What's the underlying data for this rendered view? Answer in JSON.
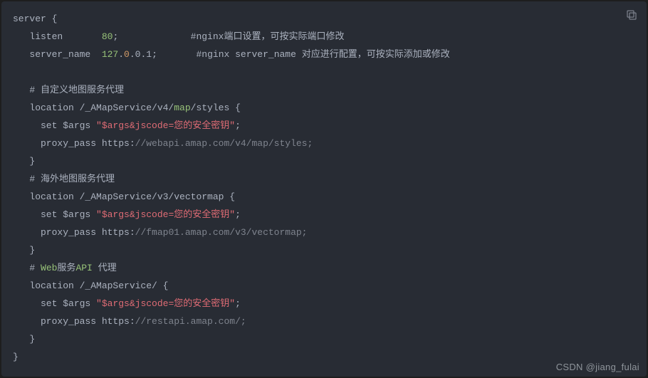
{
  "watermark": "CSDN @jiang_fulai",
  "code": {
    "l1": {
      "a": "server {"
    },
    "l2": {
      "a": "   listen       ",
      "b": "80",
      "c": ";             ",
      "d": "#nginx端口设置，可按实际端口修改"
    },
    "l3": {
      "a": "   server_name  ",
      "b": "127",
      "c": ".",
      "d": "0",
      "e": ".0.1;       ",
      "f": "#nginx server_name 对应进行配置，可按实际添加或修改"
    },
    "l4": {
      "a": ""
    },
    "l5": {
      "a": "   ",
      "b": "# 自定义地图服务代理"
    },
    "l6": {
      "a": "   location /_AMapService/v4/",
      "b": "map",
      "c": "/styles {"
    },
    "l7": {
      "a": "     set $args ",
      "b": "\"$args&jscode=您的安全密钥\"",
      "c": ";"
    },
    "l8": {
      "a": "     proxy_pass https:",
      "b": "//webapi.amap.com/v4/map/styles;"
    },
    "l9": {
      "a": "   }"
    },
    "l10": {
      "a": "   ",
      "b": "# 海外地图服务代理"
    },
    "l11": {
      "a": "   location /_AMapService/v3/vectormap {"
    },
    "l12": {
      "a": "     set $args ",
      "b": "\"$args&jscode=您的安全密钥\"",
      "c": ";"
    },
    "l13": {
      "a": "     proxy_pass https:",
      "b": "//fmap01.amap.com/v3/vectormap;"
    },
    "l14": {
      "a": "   }"
    },
    "l15": {
      "a": "   ",
      "b": "# ",
      "c": "Web",
      "d": "服务",
      "e": "API",
      "f": " 代理"
    },
    "l16": {
      "a": "   location /_AMapService/ {"
    },
    "l17": {
      "a": "     set $args ",
      "b": "\"$args&jscode=您的安全密钥\"",
      "c": ";"
    },
    "l18": {
      "a": "     proxy_pass https:",
      "b": "//restapi.amap.com/;"
    },
    "l19": {
      "a": "   }"
    },
    "l20": {
      "a": "}"
    }
  }
}
